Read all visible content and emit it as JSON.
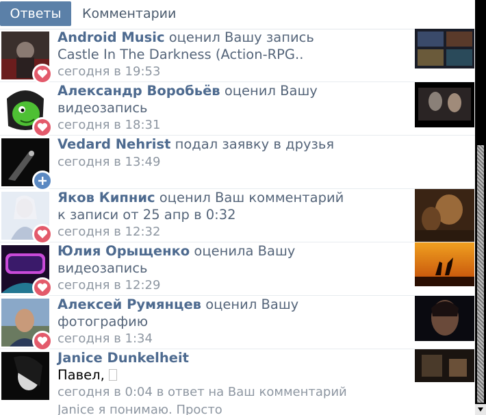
{
  "tabs": {
    "active": "Ответы",
    "second": "Комментарии"
  },
  "items": [
    {
      "name": "Android Music",
      "action": " оценил Вашу запись",
      "line2": "Castle In The Darkness (Action-RPG..",
      "time": "сегодня в 19:53",
      "badge": "heart-icon"
    },
    {
      "name": "Александр Воробьёв",
      "action": " оценил Вашу",
      "line2": "видеозапись",
      "time": "сегодня в 18:31",
      "badge": "heart-icon"
    },
    {
      "name": "Vedard Nehrist",
      "action": " подал заявку в друзья",
      "time": "сегодня в 13:49",
      "badge": "plus-icon"
    },
    {
      "name": "Яков Кипнис",
      "action": " оценил Ваш комментарий",
      "line2": "к записи от 25 апр в 0:32",
      "time": "сегодня в 12:32",
      "badge": "heart-icon"
    },
    {
      "name": "Юлия Орыщенко",
      "action": " оценила Вашу",
      "line2": "видеозапись",
      "time": "сегодня в 12:29",
      "badge": "heart-icon"
    },
    {
      "name": "Алексей Румянцев",
      "action": " оценил Вашу",
      "line2": "фотографию",
      "time": "сегодня в 1:34",
      "badge": "heart-icon"
    },
    {
      "name": "Janice Dunkelheit",
      "message": "Павел, ",
      "time": "сегодня в 0:04",
      "reply": " в ответ на Ваш комментарий",
      "snippet": "Janice я понимаю. Просто"
    }
  ],
  "colors": {
    "tab_active": "#5b80a8",
    "name_link": "#4d6a8f",
    "like_badge": "#e35a6b",
    "add_badge": "#5b89c2"
  }
}
